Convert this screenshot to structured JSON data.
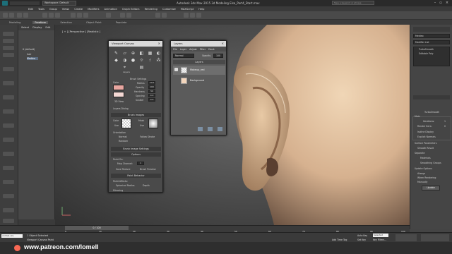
{
  "app": {
    "window_title": "Autodesk 3ds Max 2015    3d Modeling Elsa_Part4_Start.max",
    "workspace": "Workspace: Default",
    "search_placeholder": "Type a keyword or phrase"
  },
  "menu": [
    "Edit",
    "Tools",
    "Group",
    "Views",
    "Create",
    "Modifiers",
    "Animation",
    "Graph Editors",
    "Rendering",
    "Customize",
    "MAXScript",
    "Help"
  ],
  "ribbon_tabs": [
    "Modeling",
    "Freeform",
    "Selection",
    "Object Paint",
    "Populate"
  ],
  "active_ribbon_tab": "Freeform",
  "scene_explorer": {
    "tabs": [
      "Select",
      "Display",
      "Edit"
    ],
    "items": [
      "0 (default)",
      "hair",
      "Medieo"
    ],
    "selected": "Medieo"
  },
  "viewport": {
    "label": "[ + ] [Perspective ] [Realistic ]"
  },
  "viewport_canvas": {
    "title": "Viewport Canvas",
    "brush_settings": "Brush Settings",
    "color_label": "Color",
    "fields": [
      {
        "label": "Radius",
        "value": "10.0"
      },
      {
        "label": "Opacity",
        "value": "100"
      },
      {
        "label": "Hardness",
        "value": "50"
      },
      {
        "label": "Spacing",
        "value": "0.0"
      },
      {
        "label": "Scatter",
        "value": "0.0"
      }
    ],
    "view_3d": "3D View",
    "layers_dialog": "Layers Dialog",
    "brush_images": "Brush Images",
    "bi_color": "Color",
    "bi_mask": "Mask",
    "bi_use": "Use",
    "orientation": "Orientation",
    "orient_opts": [
      "Normal",
      "Follow Stroke",
      "Random"
    ],
    "brush_image_settings": "Brush Image Settings",
    "options": "Options",
    "paint_on": "Paint On:",
    "map_channel_label": "Map Channel:",
    "map_channel": "1",
    "save_texture": "Save Texture",
    "brush_preview": "Brush Preview",
    "paint_behavior": "Paint Behavior",
    "paint_affects": "Paint Affects:",
    "spherical_radius": "Spherical Radius",
    "depth": "Depth",
    "mirroring": "Mirroring"
  },
  "layers": {
    "title": "Layers",
    "menu": [
      "File",
      "Layer",
      "Adjust",
      "Filter",
      "Dock"
    ],
    "blend_mode": "Normal",
    "opacity_label": "Opacity",
    "opacity": "100",
    "header": "Layers",
    "rows": [
      "Makeup_red",
      "Background"
    ]
  },
  "modify_panel": {
    "object_name": "Medieo",
    "modifier_list": "Modifier List",
    "stack": [
      "TurboSmooth",
      "Editable Poly"
    ],
    "turbosmooth": "TurboSmooth",
    "main": "Main",
    "iterations_label": "Iterations:",
    "iterations": "1",
    "render_iters_label": "Render Iters:",
    "render_iters": "0",
    "isoline_display": "Isoline Display",
    "explicit_normals": "Explicit Normals",
    "surface_parameters": "Surface Parameters",
    "smooth_result": "Smooth Result",
    "separate": "Separate",
    "materials": "Materials",
    "smoothing_groups": "Smoothing Groups",
    "update_options": "Update Options",
    "always": "Always",
    "when_rendering": "When Rendering",
    "manually": "Manually",
    "update": "Update"
  },
  "timeline": {
    "slider": "0 / 100",
    "ticks": [
      "0",
      "10",
      "20",
      "30",
      "40",
      "50",
      "60",
      "70",
      "80",
      "90",
      "100"
    ]
  },
  "status": {
    "selected": "1 Object Selected",
    "hint": "Viewport Canvas Paint",
    "maxscript": "undo(1,on)",
    "add_time_tag": "Add Time Tag",
    "auto_key": "Auto Key",
    "set_key": "Set Key",
    "key_filters": "Key Filters...",
    "selected_box": "Selected"
  },
  "watermark": "www.patreon.com/lomell"
}
